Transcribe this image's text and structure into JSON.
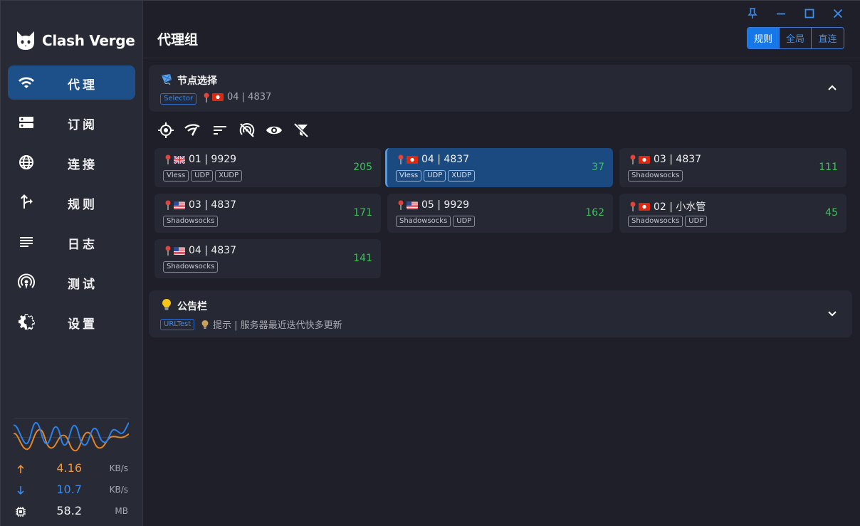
{
  "app": {
    "name": "Clash Verge",
    "page_title": "代理组"
  },
  "nav": {
    "items": [
      {
        "label": "代理",
        "icon": "wifi-icon",
        "active": true
      },
      {
        "label": "订阅",
        "icon": "storage-icon",
        "active": false
      },
      {
        "label": "连接",
        "icon": "globe-icon",
        "active": false
      },
      {
        "label": "规则",
        "icon": "fork-icon",
        "active": false
      },
      {
        "label": "日志",
        "icon": "list-icon",
        "active": false
      },
      {
        "label": "测试",
        "icon": "radar-icon",
        "active": false
      },
      {
        "label": "设置",
        "icon": "gear-icon",
        "active": false
      }
    ]
  },
  "stats": {
    "upload": {
      "value": "4.16",
      "unit": "KB/s",
      "color": "#f0973a"
    },
    "download": {
      "value": "10.7",
      "unit": "KB/s",
      "color": "#3a8ef0"
    },
    "memory": {
      "value": "58.2",
      "unit": "MB",
      "color": "#f0f0f0"
    }
  },
  "modes": {
    "rule": "规则",
    "global": "全局",
    "direct": "直连",
    "active": "rule"
  },
  "groups": {
    "selector": {
      "name": "节点选择",
      "type": "Selector",
      "now": "04 | 4837",
      "expanded": true,
      "proxies": [
        {
          "flag": "uk",
          "name": "01 | 9929",
          "tags": [
            "Vless",
            "UDP",
            "XUDP"
          ],
          "delay": "205",
          "selected": false
        },
        {
          "flag": "hk",
          "name": "04 | 4837",
          "tags": [
            "Vless",
            "UDP",
            "XUDP"
          ],
          "delay": "37",
          "selected": true
        },
        {
          "flag": "hk",
          "name": "03 | 4837",
          "tags": [
            "Shadowsocks"
          ],
          "delay": "111",
          "selected": false
        },
        {
          "flag": "us",
          "name": "03 | 4837",
          "tags": [
            "Shadowsocks"
          ],
          "delay": "171",
          "selected": false
        },
        {
          "flag": "us",
          "name": "05 | 9929",
          "tags": [
            "Shadowsocks",
            "UDP"
          ],
          "delay": "162",
          "selected": false
        },
        {
          "flag": "hk",
          "name": "02 | 小水管",
          "tags": [
            "Shadowsocks",
            "UDP"
          ],
          "delay": "45",
          "selected": false
        },
        {
          "flag": "us",
          "name": "04 | 4837",
          "tags": [
            "Shadowsocks"
          ],
          "delay": "141",
          "selected": false
        }
      ]
    },
    "notice": {
      "name": "公告栏",
      "type": "URLTest",
      "now": "提示 | 服务器最近迭代快多更新",
      "expanded": false
    }
  },
  "colors": {
    "accent": "#1677e8",
    "delay_good": "#3cc15a",
    "sidebar_bg": "#282a36",
    "main_bg": "#1e1f29"
  }
}
